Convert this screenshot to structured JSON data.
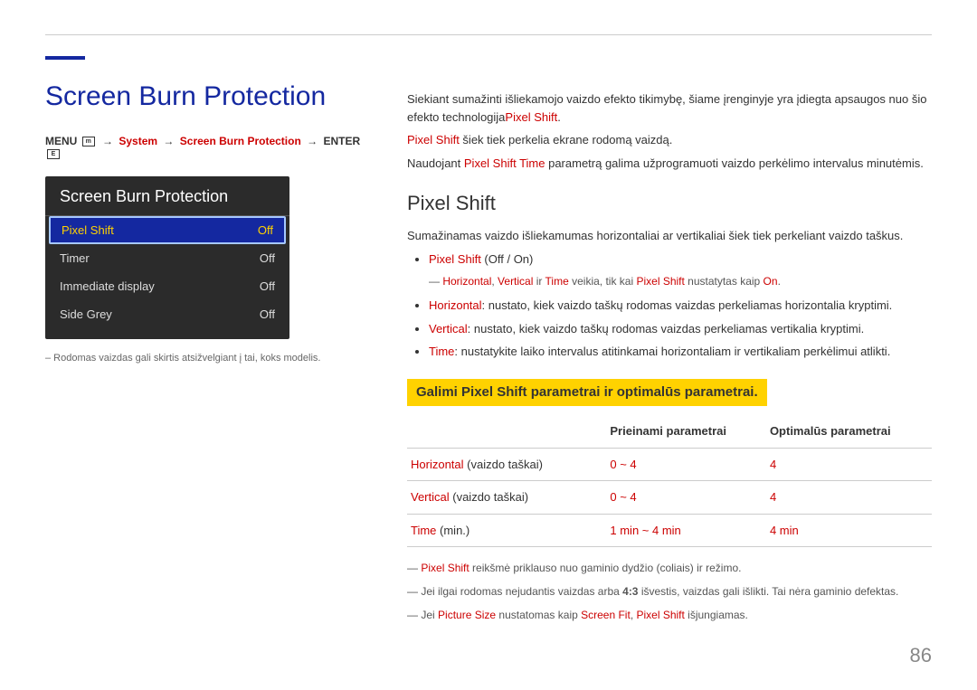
{
  "page_number": "86",
  "main_title": "Screen Burn Protection",
  "breadcrumb": {
    "menu": "MENU",
    "system": "System",
    "sbp": "Screen Burn Protection",
    "enter": "ENTER"
  },
  "screenshot": {
    "title": "Screen Burn Protection",
    "rows": [
      {
        "label": "Pixel Shift",
        "value": "Off",
        "selected": true
      },
      {
        "label": "Timer",
        "value": "Off",
        "selected": false
      },
      {
        "label": "Immediate display",
        "value": "Off",
        "selected": false
      },
      {
        "label": "Side Grey",
        "value": "Off",
        "selected": false
      }
    ]
  },
  "left_footnote": "– Rodomas vaizdas gali skirtis atsižvelgiant į tai, koks modelis.",
  "intro": {
    "p1_a": "Siekiant sumažinti išliekamojo vaizdo efekto tikimybę, šiame įrenginyje yra įdiegta apsaugos nuo šio efekto technologija",
    "p1_b": "Pixel Shift",
    "p1_c": ".",
    "p2_a": "Pixel Shift",
    "p2_b": " šiek tiek perkelia ekrane rodomą vaizdą.",
    "p3_a": "Naudojant ",
    "p3_b": "Pixel Shift Time",
    "p3_c": " parametrą galima užprogramuoti vaizdo perkėlimo intervalus minutėmis."
  },
  "section_title": "Pixel Shift",
  "section_intro": "Sumažinamas vaizdo išliekamumas horizontaliai ar vertikaliai šiek tiek perkeliant vaizdo taškus.",
  "bullet1": {
    "label": "Pixel Shift",
    "options": " (Off / On)"
  },
  "subnote1": {
    "h": "Horizontal",
    "v": "Vertical",
    "t": "Time",
    "mid": " veikia, tik kai ",
    "ps": "Pixel Shift",
    "setas": " nustatytas kaip ",
    "on": "On",
    "dot": "."
  },
  "bullet2": {
    "label": "Horizontal",
    "text": ": nustato, kiek vaizdo taškų rodomas vaizdas perkeliamas horizontalia kryptimi."
  },
  "bullet3": {
    "label": "Vertical",
    "text": ": nustato, kiek vaizdo taškų rodomas vaizdas perkeliamas vertikalia kryptimi."
  },
  "bullet4": {
    "label": "Time",
    "text": ": nustatykite laiko intervalus atitinkamai horizontaliam ir vertikaliam perkėlimui atlikti."
  },
  "yellow_heading": "Galimi Pixel Shift parametrai ir optimalūs parametrai.",
  "table": {
    "headers": [
      "",
      "Prieinami parametrai",
      "Optimalūs parametrai"
    ],
    "rows": [
      {
        "label_red": "Horizontal",
        "label_rest": " (vaizdo taškai)",
        "available": "0 ~ 4",
        "optimal": "4"
      },
      {
        "label_red": "Vertical",
        "label_rest": " (vaizdo taškai)",
        "available": "0 ~ 4",
        "optimal": "4"
      },
      {
        "label_red": "Time",
        "label_rest": " (min.)",
        "available": "1 min ~ 4 min",
        "optimal": "4 min"
      }
    ]
  },
  "after_notes": {
    "n1_a": "Pixel Shift",
    "n1_b": " reikšmė priklauso nuo gaminio dydžio (coliais) ir režimo.",
    "n2_a": "Jei ilgai rodomas nejudantis vaizdas arba ",
    "n2_b": "4:3",
    "n2_c": " išvestis, vaizdas gali išlikti. Tai nėra gaminio defektas.",
    "n3_a": "Jei ",
    "n3_b": "Picture Size",
    "n3_c": " nustatomas kaip ",
    "n3_d": "Screen Fit",
    "n3_e": ", ",
    "n3_f": "Pixel Shift",
    "n3_g": " išjungiamas."
  }
}
